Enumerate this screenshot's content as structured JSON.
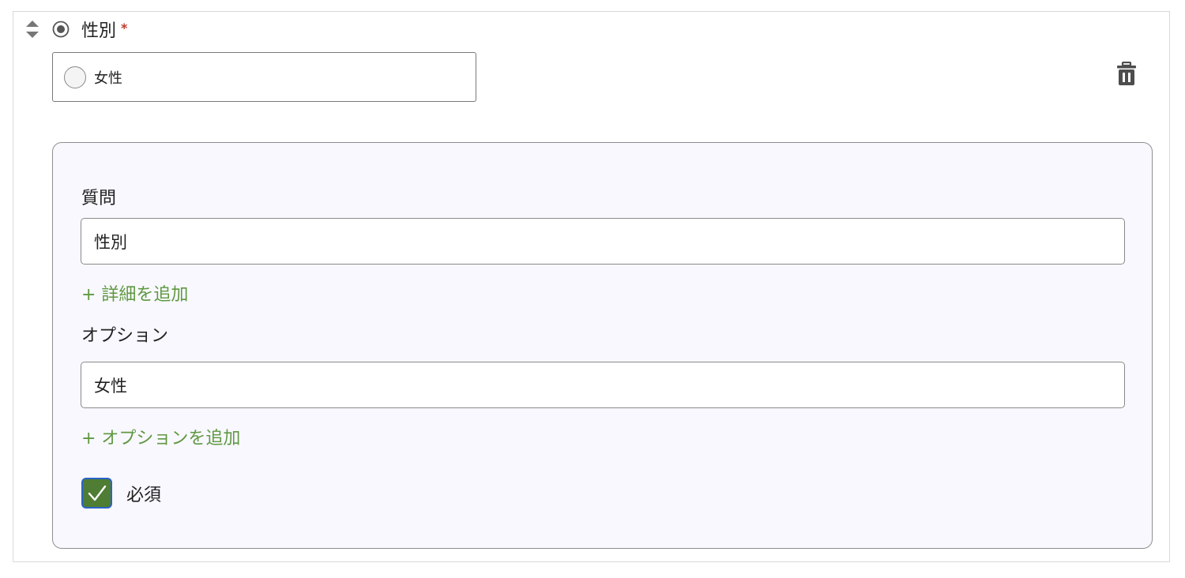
{
  "question": {
    "title": "性別",
    "required_marker": "*",
    "preview_option": "女性"
  },
  "editor": {
    "question_label": "質問",
    "question_value": "性別",
    "add_detail_link": "+ 詳細を追加",
    "options_label": "オプション",
    "option_value": "女性",
    "add_option_link": "+ オプションを追加",
    "required_label": "必須",
    "required_checked": true
  },
  "icons": {
    "drag": "drag-handle-icon",
    "type": "radio-button-icon",
    "delete": "trash-icon",
    "check": "checkmark-icon"
  },
  "colors": {
    "accent_green": "#5f9841",
    "checkbox_fill": "#4e7d33",
    "checkbox_border": "#2c63c6",
    "required_star": "#c0392b"
  }
}
